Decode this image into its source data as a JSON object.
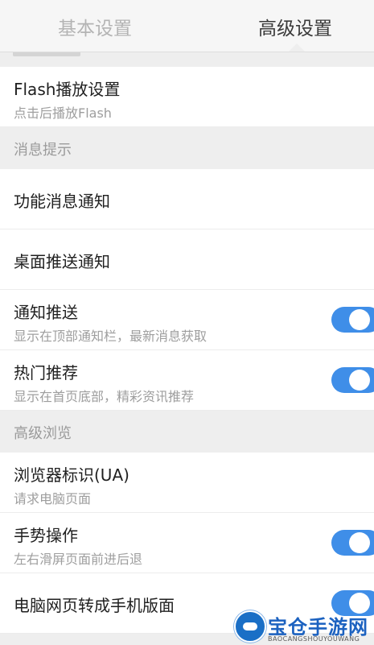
{
  "tabs": [
    {
      "label": "基本设置",
      "active": false
    },
    {
      "label": "高级设置",
      "active": true
    }
  ],
  "rows": {
    "flash": {
      "title": "Flash播放设置",
      "subtitle": "点击后播放Flash"
    },
    "feature_notify": {
      "title": "功能消息通知"
    },
    "desktop_push": {
      "title": "桌面推送通知"
    },
    "notify_push": {
      "title": "通知推送",
      "subtitle": "显示在顶部通知栏，最新消息获取",
      "enabled": true
    },
    "hot_recommend": {
      "title": "热门推荐",
      "subtitle": "显示在首页底部，精彩资讯推荐",
      "enabled": true
    },
    "ua": {
      "title": "浏览器标识(UA)",
      "subtitle": "请求电脑页面"
    },
    "gesture": {
      "title": "手势操作",
      "subtitle": "左右滑屏页面前进后退",
      "enabled": true
    },
    "mobile_view": {
      "title": "电脑网页转成手机版面",
      "enabled": true
    }
  },
  "sections": {
    "notifications": "消息提示",
    "advanced_browsing": "高级浏览"
  },
  "watermark": {
    "name": "宝仓手游网",
    "url": "BAOCANGSHOUYOUWANG"
  },
  "colors": {
    "accent": "#3f8ee8",
    "section_bg": "#eeeeee",
    "row_bg": "#ffffff"
  }
}
